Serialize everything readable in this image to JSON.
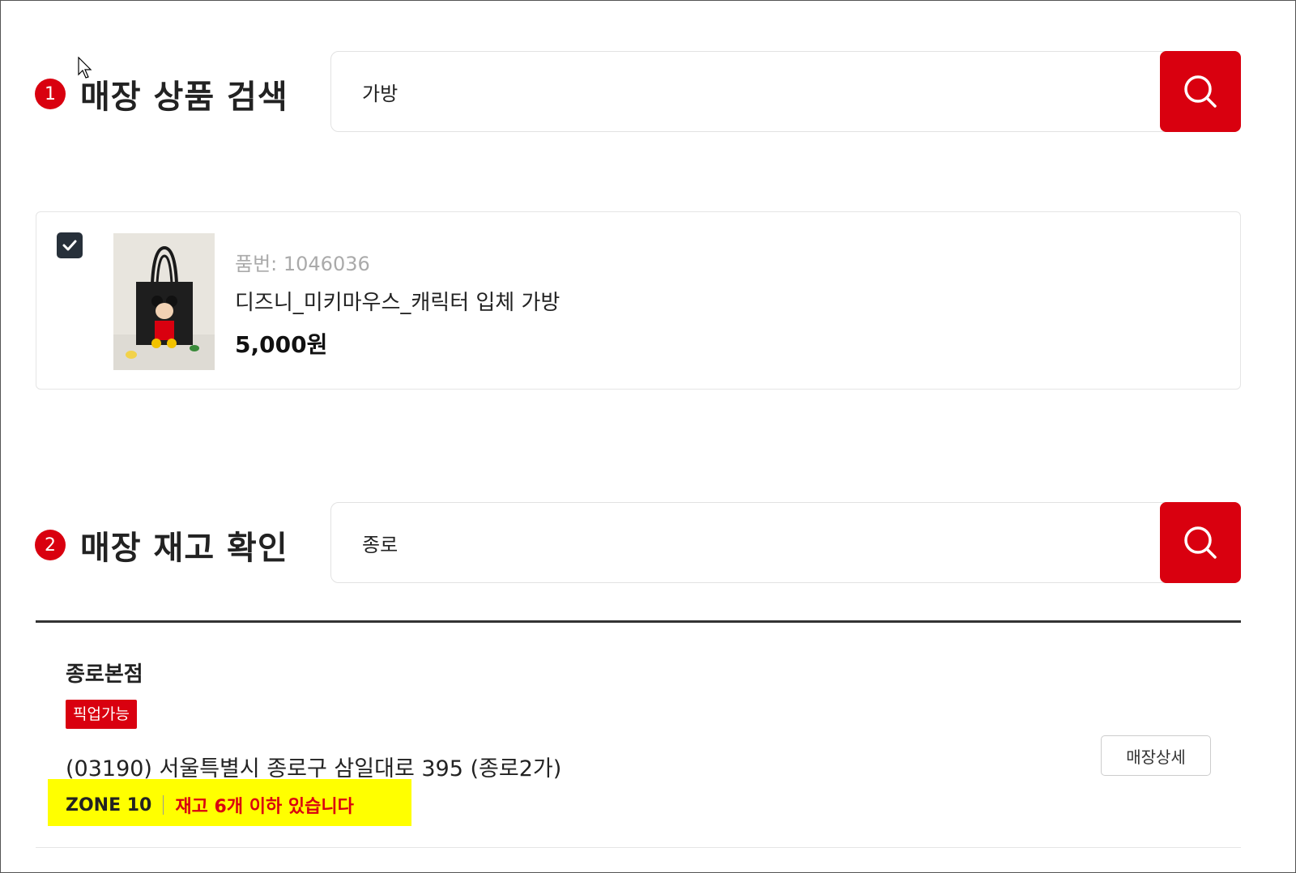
{
  "product_search": {
    "step_number": "1",
    "title": "매장 상품 검색",
    "query": "가방"
  },
  "product": {
    "code": "품번: 1046036",
    "name": "디즈니_미키마우스_캐릭터 입체 가방",
    "price": "5,000원",
    "checked": true
  },
  "stock_search": {
    "step_number": "2",
    "title": "매장 재고 확인",
    "query": "종로"
  },
  "store": {
    "name": "종로본점",
    "badge": "픽업가능",
    "address": "(03190) 서울특별시 종로구 삼일대로 395 (종로2가)",
    "detail_button": "매장상세",
    "zone": "ZONE 10",
    "stock_message": "재고 6개 이하 있습니다"
  },
  "colors": {
    "accent": "#d9000f",
    "highlight": "#ffff00",
    "checkbox": "#27303a"
  }
}
